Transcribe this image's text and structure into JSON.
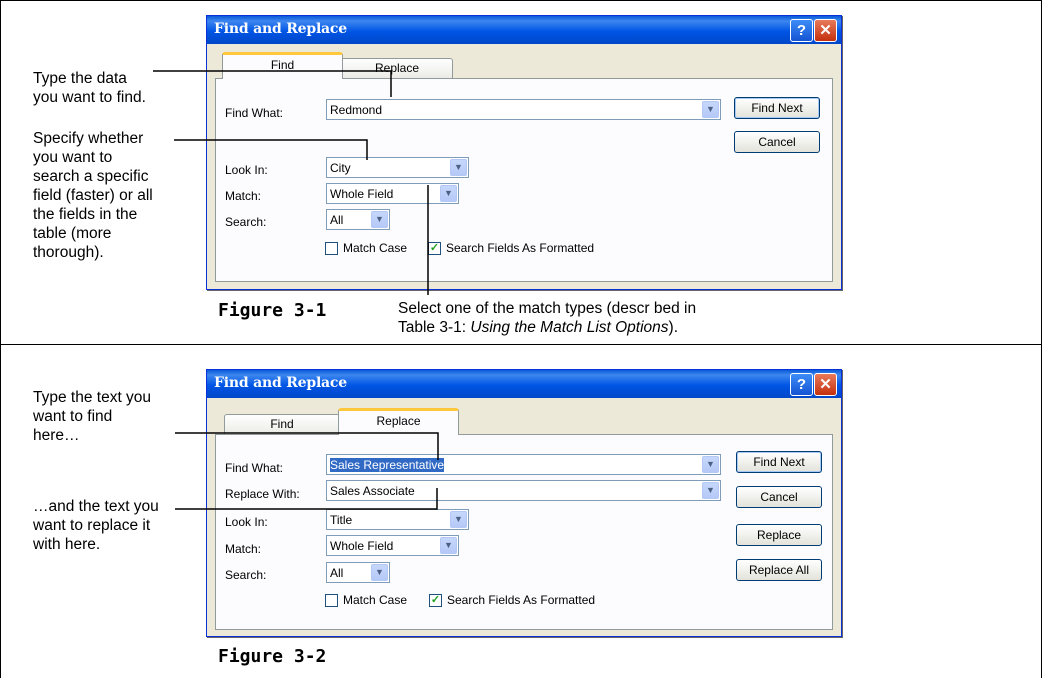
{
  "annotations": {
    "fig1_note1": "Type the data\nyou want to find.",
    "fig1_note2": "Specify whether\nyou want to\nsearch a specific\nfield (faster) or all\nthe fields in the\ntable (more\nthorough).",
    "fig1_note3_line1": "Select one of the match types (descr bed in",
    "fig1_note3_line2a": "Table 3-1: ",
    "fig1_note3_line2b": "Using the Match List Options",
    "fig1_note3_line2c": ").",
    "fig2_note1": "Type the text you\nwant to find\nhere…",
    "fig2_note2": "…and the text you\nwant to replace it\nwith here."
  },
  "figure_labels": {
    "fig1": "Figure 3-1",
    "fig2": "Figure 3-2"
  },
  "dialog1": {
    "title": "Find and Replace",
    "help": "?",
    "close": "✕",
    "tabs": [
      "Find",
      "Replace"
    ],
    "find_what_label": "Find What:",
    "find_what_value": "Redmond",
    "look_in_label": "Look In:",
    "look_in_value": "City",
    "match_label": "Match:",
    "match_value": "Whole Field",
    "search_label": "Search:",
    "search_value": "All",
    "match_case_label": "Match Case",
    "search_formatted_label": "Search Fields As Formatted",
    "find_next": "Find Next",
    "cancel": "Cancel"
  },
  "dialog2": {
    "title": "Find and Replace",
    "help": "?",
    "close": "✕",
    "tabs": [
      "Find",
      "Replace"
    ],
    "find_what_label": "Find What:",
    "find_what_value": "Sales Representative",
    "replace_with_label": "Replace With:",
    "replace_with_value": "Sales Associate",
    "look_in_label": "Look In:",
    "look_in_value": "Title",
    "match_label": "Match:",
    "match_value": "Whole Field",
    "search_label": "Search:",
    "search_value": "All",
    "match_case_label": "Match Case",
    "search_formatted_label": "Search Fields As Formatted",
    "find_next": "Find Next",
    "cancel": "Cancel",
    "replace": "Replace",
    "replace_all": "Replace All"
  },
  "icons": {
    "dropdown": "chevron-down-icon",
    "check": "checkmark-icon"
  },
  "colors": {
    "titlebar": "#0055e5",
    "dialog_bg": "#ece9d8",
    "tab_highlight": "#ffc83c",
    "selection": "#316ac5"
  }
}
